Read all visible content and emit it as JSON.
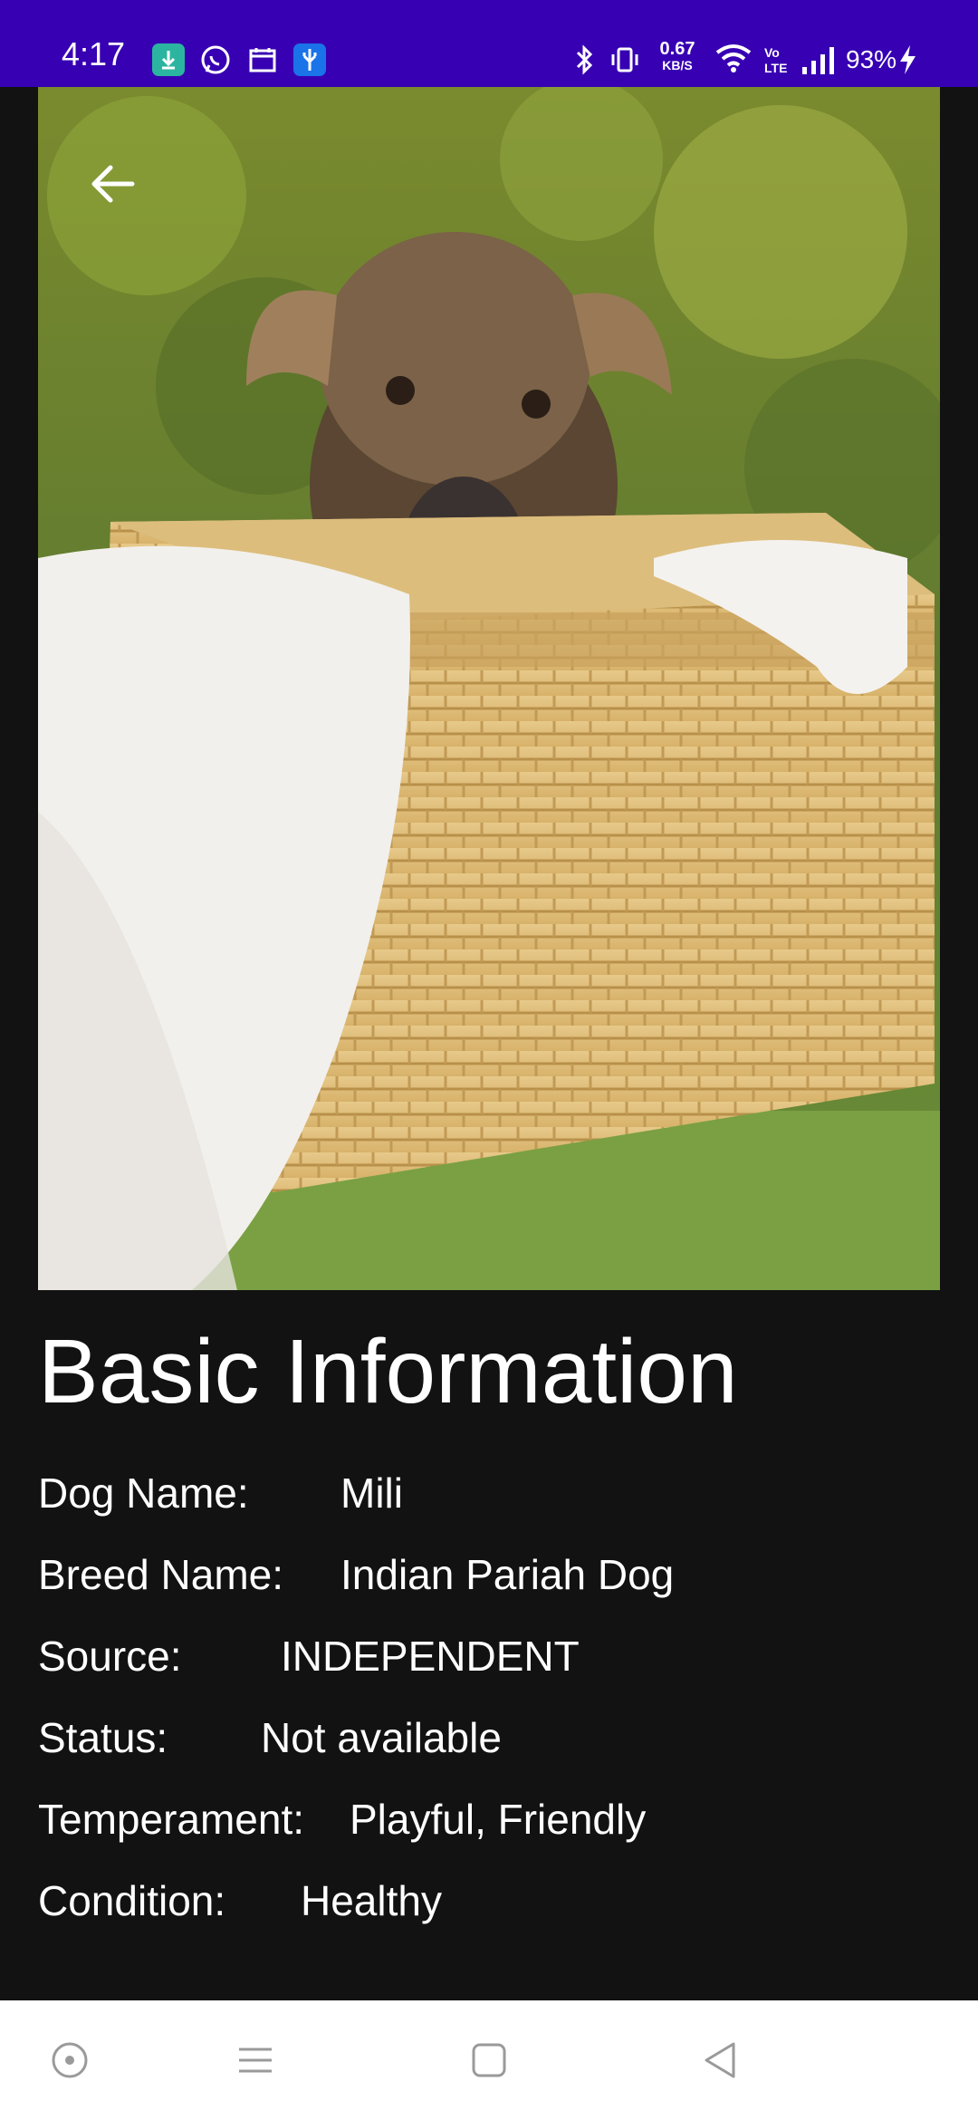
{
  "status_bar": {
    "time": "4:17",
    "notification_icons": [
      "download-icon",
      "whatsapp-icon",
      "calendar-icon",
      "usb-icon"
    ],
    "network_speed": "0.67",
    "network_speed_unit": "KB/S",
    "battery_percent": "93%",
    "colors": {
      "background": "#3700b3"
    }
  },
  "photo": {
    "subject": "puppy-in-basket-photo"
  },
  "header": {
    "back_icon": "arrow-left-icon"
  },
  "section": {
    "title": "Basic Information",
    "fields": [
      {
        "label": "Dog Name:",
        "value": "Mili"
      },
      {
        "label": "Breed Name:",
        "value": "Indian Pariah Dog"
      },
      {
        "label": "Source:",
        "value": "INDEPENDENT"
      },
      {
        "label": "Status:",
        "value": "Not available"
      },
      {
        "label": "Temperament:",
        "value": "Playful, Friendly"
      },
      {
        "label": "Condition:",
        "value": "Healthy"
      }
    ]
  },
  "nav_bar": {
    "buttons": [
      "assistant-button",
      "recents-button",
      "home-button",
      "back-button"
    ]
  },
  "colors": {
    "page_background": "#121212",
    "text": "#ffffff"
  }
}
